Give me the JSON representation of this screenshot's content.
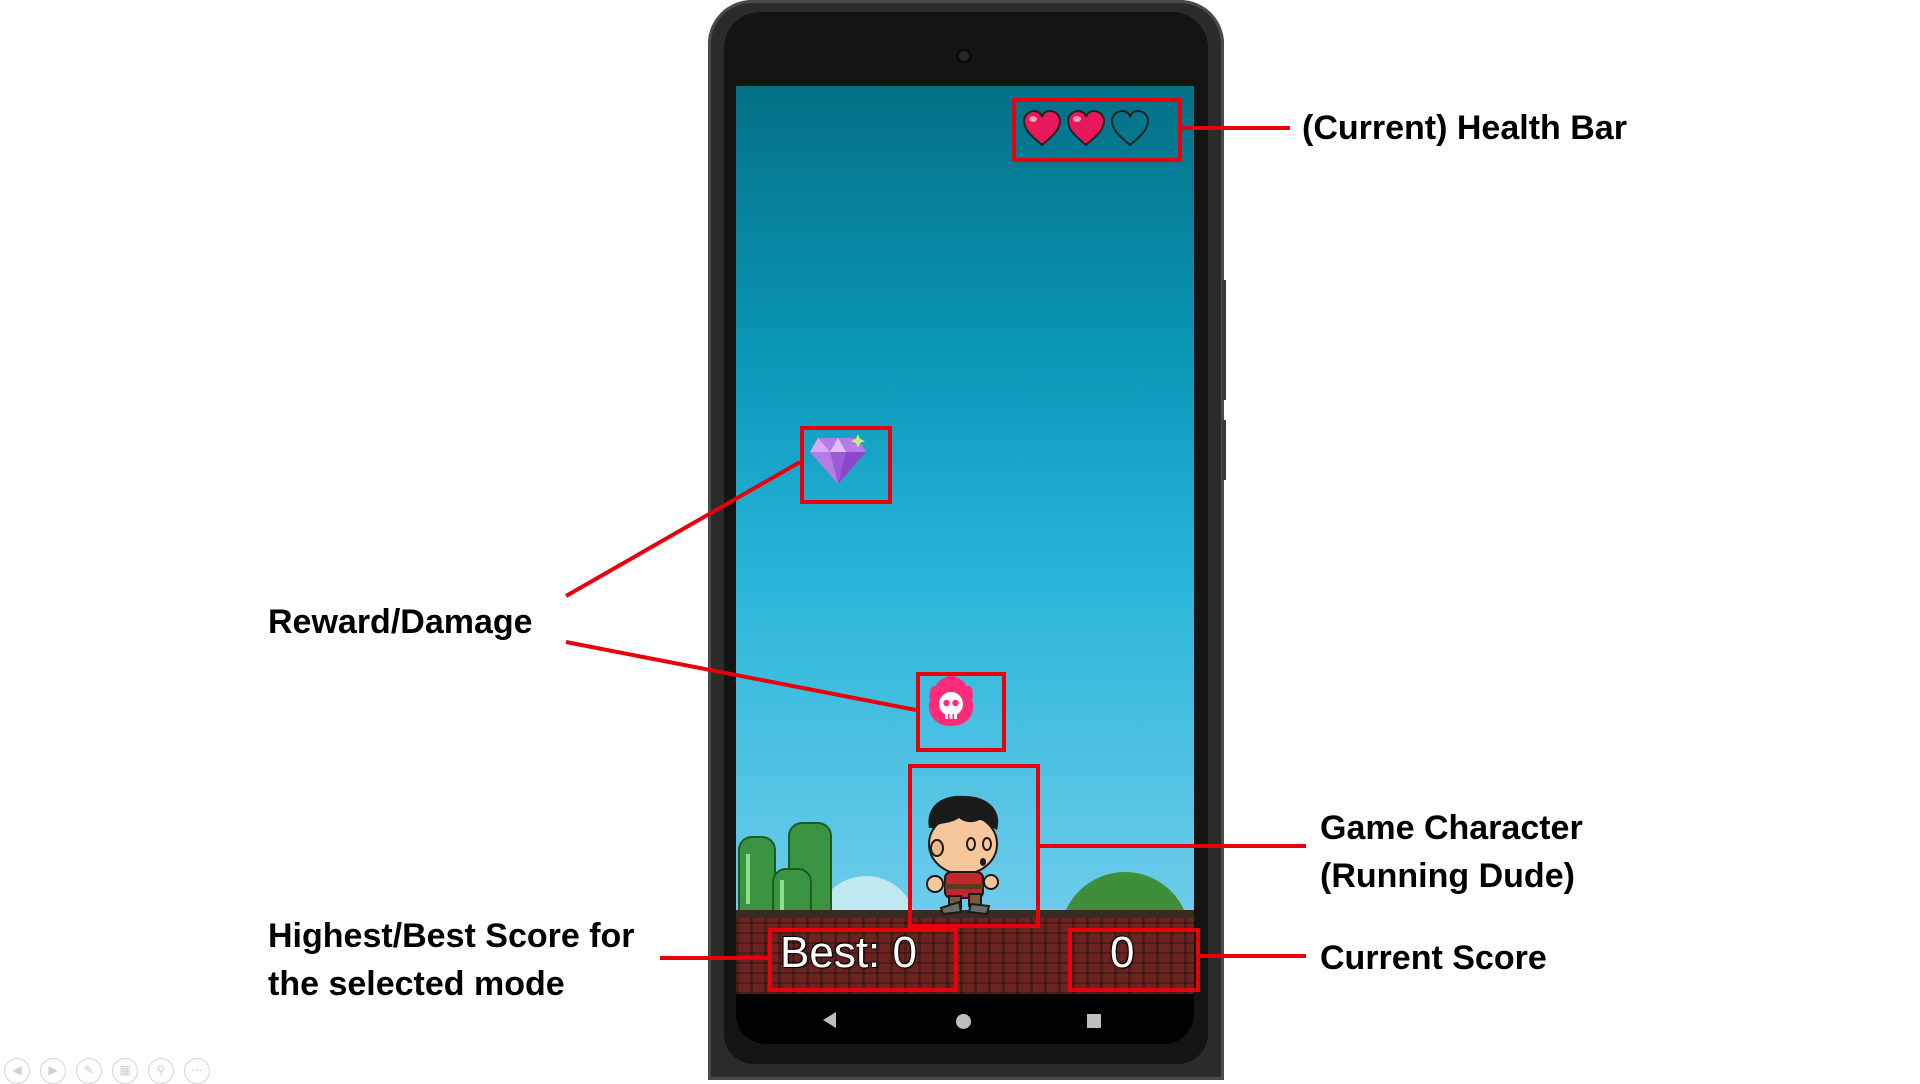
{
  "health": {
    "hearts": [
      {
        "state": "full",
        "icon": "heart-full-icon"
      },
      {
        "state": "full",
        "icon": "heart-full-icon"
      },
      {
        "state": "empty",
        "icon": "heart-empty-icon"
      }
    ]
  },
  "score": {
    "best_label": "Best: 0",
    "current": "0"
  },
  "items": {
    "reward_icon": "diamond-gem-icon",
    "damage_icon": "flaming-skull-icon",
    "character_icon": "running-dude-character"
  },
  "annotations": {
    "health_bar": "(Current) Health Bar",
    "reward_damage": "Reward/Damage",
    "character_line1": "Game Character",
    "character_line2": "(Running Dude)",
    "best_line1": "Highest/Best Score for",
    "best_line2": "the selected mode",
    "current_score": "Current Score"
  },
  "colors": {
    "annotation_red": "#e8000b",
    "heart_pink": "#e8185a",
    "sky_top": "#047086",
    "sky_bottom": "#7ed1ef"
  }
}
